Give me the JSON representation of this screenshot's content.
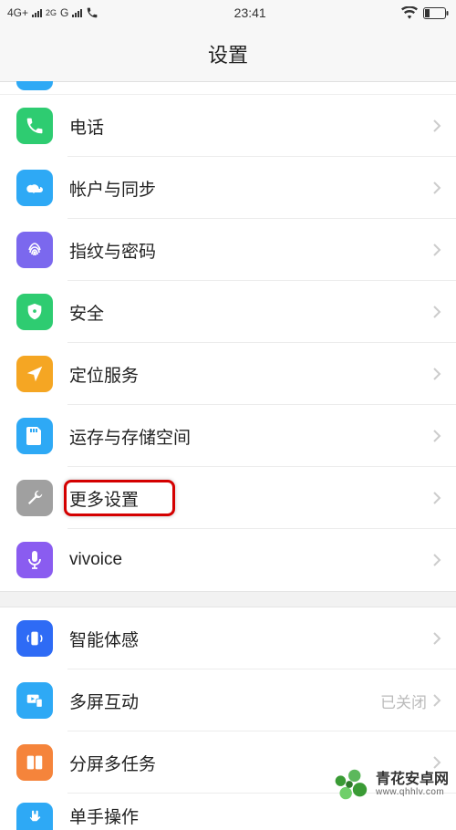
{
  "status": {
    "net1": "4G+",
    "net2": "2G",
    "net3": "G",
    "time": "23:41"
  },
  "header": {
    "title": "设置"
  },
  "rows": {
    "phone": {
      "label": "电话"
    },
    "account": {
      "label": "帐户与同步"
    },
    "fingerprint": {
      "label": "指纹与密码"
    },
    "security": {
      "label": "安全"
    },
    "location": {
      "label": "定位服务"
    },
    "storage": {
      "label": "运存与存储空间"
    },
    "more": {
      "label": "更多设置"
    },
    "vivoice": {
      "label": "vivoice"
    },
    "motion": {
      "label": "智能体感"
    },
    "multiscreen": {
      "label": "多屏互动",
      "value": "已关闭"
    },
    "splitscreen": {
      "label": "分屏多任务"
    },
    "onehand": {
      "label": "单手操作"
    }
  },
  "watermark": {
    "title": "青花安卓网",
    "url": "www.qhhlv.com"
  }
}
